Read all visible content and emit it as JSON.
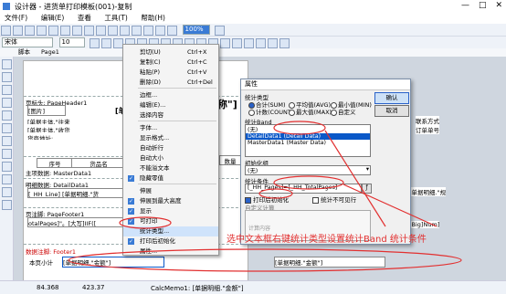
{
  "window": {
    "title": "设计器 - 进货单打印模板(001)-复制"
  },
  "menu": [
    "文件(F)",
    "编辑(E)",
    "查看",
    "工具(T)",
    "帮助(H)"
  ],
  "toolbar": {
    "font": "宋体",
    "size": "10",
    "zoom": "100%"
  },
  "tab": "脚本",
  "page_tab": "Page1",
  "bands": [
    {
      "label": "页标头: PageHeader1"
    },
    {
      "label": "主项数据: MasterData1"
    },
    {
      "label": "明细数据: DetailData1"
    },
    {
      "label": "页注脚: PageFooter1"
    },
    {
      "label": "数据注脚: Footer1"
    }
  ],
  "cells": {
    "image": "[图片]",
    "company": "[单据主体.\"往来",
    "company2": "[单据主体.\"收货",
    "header_addr": "货商地址:",
    "seq": "序号",
    "goods": "货品名",
    "qty": "数量",
    "detail": "[_HH_Line] [单据明细.\"货",
    "detail_r": "[单据明细.\"规",
    "footer_total": "otalPages]\"。[大写]IIF([",
    "footer_r": "[Big]Num]",
    "sum_label": "本页小计",
    "sum1": "[单据明细.\"金额\"]",
    "sum2": "[单据明细.\"金额\"]",
    "title_big": "称\"]",
    "title_open": "[单",
    "side1": "联系方式",
    "side2": "订单单号"
  },
  "context_menu": [
    {
      "label": "剪切(U)",
      "key": "Ctrl+X"
    },
    {
      "label": "复制(C)",
      "key": "Ctrl+C"
    },
    {
      "label": "粘贴(P)",
      "key": "Ctrl+V"
    },
    {
      "label": "删除(D)",
      "key": "Ctrl+Del"
    },
    {
      "label": "边框...",
      "key": ""
    },
    {
      "label": "编辑(E)...",
      "key": ""
    },
    {
      "label": "选择内容",
      "key": ""
    },
    {
      "label": "字体...",
      "key": ""
    },
    {
      "label": "显示格式...",
      "key": ""
    },
    {
      "label": "自动折行",
      "key": ""
    },
    {
      "label": "自动大小",
      "key": ""
    },
    {
      "label": "不能溢文本",
      "key": ""
    },
    {
      "label": "隐藏零值",
      "key": ""
    },
    {
      "label": "伸展",
      "key": ""
    },
    {
      "label": "伸展到最大高度",
      "key": ""
    },
    {
      "label": "显示",
      "key": ""
    },
    {
      "label": "可打印",
      "key": ""
    },
    {
      "label": "统计类型...",
      "key": ""
    },
    {
      "label": "打印后初始化",
      "key": ""
    },
    {
      "label": "属性...",
      "key": ""
    }
  ],
  "dialog": {
    "title": "属性",
    "ok": "确认",
    "cancel": "取消",
    "stat_type_label": "统计类型",
    "opts": [
      "合计(SUM)",
      "平均值(AVG)",
      "最小值(MIN)",
      "计数(COUNT)",
      "最大值(MAX)",
      "自定义"
    ],
    "band_label": "统计Band",
    "band_items": [
      "(无)",
      "DetailData1 (Detail Data)",
      "MasterData1 (Master Data)"
    ],
    "init_label": "初始化组",
    "init_value": "(无)",
    "cond_label": "统计条件",
    "cond_value": "[_HH_Pages]=[_HH_TotalPages]",
    "chk1": "打印后初始化",
    "chk2": "统计不可见行",
    "custom_label": "自定义计算",
    "calc_label": "计算内容"
  },
  "annotation": "选中文本框右键统计类型设置统计Band  统计条件",
  "status": {
    "pos1": "84.368",
    "pos2": "423.37",
    "text": "CalcMemo1: [单据明细.\"金额\"]"
  },
  "colors": {
    "accent": "#3a7bd5",
    "annotation": "#e23030",
    "selection": "#0a58c8"
  }
}
